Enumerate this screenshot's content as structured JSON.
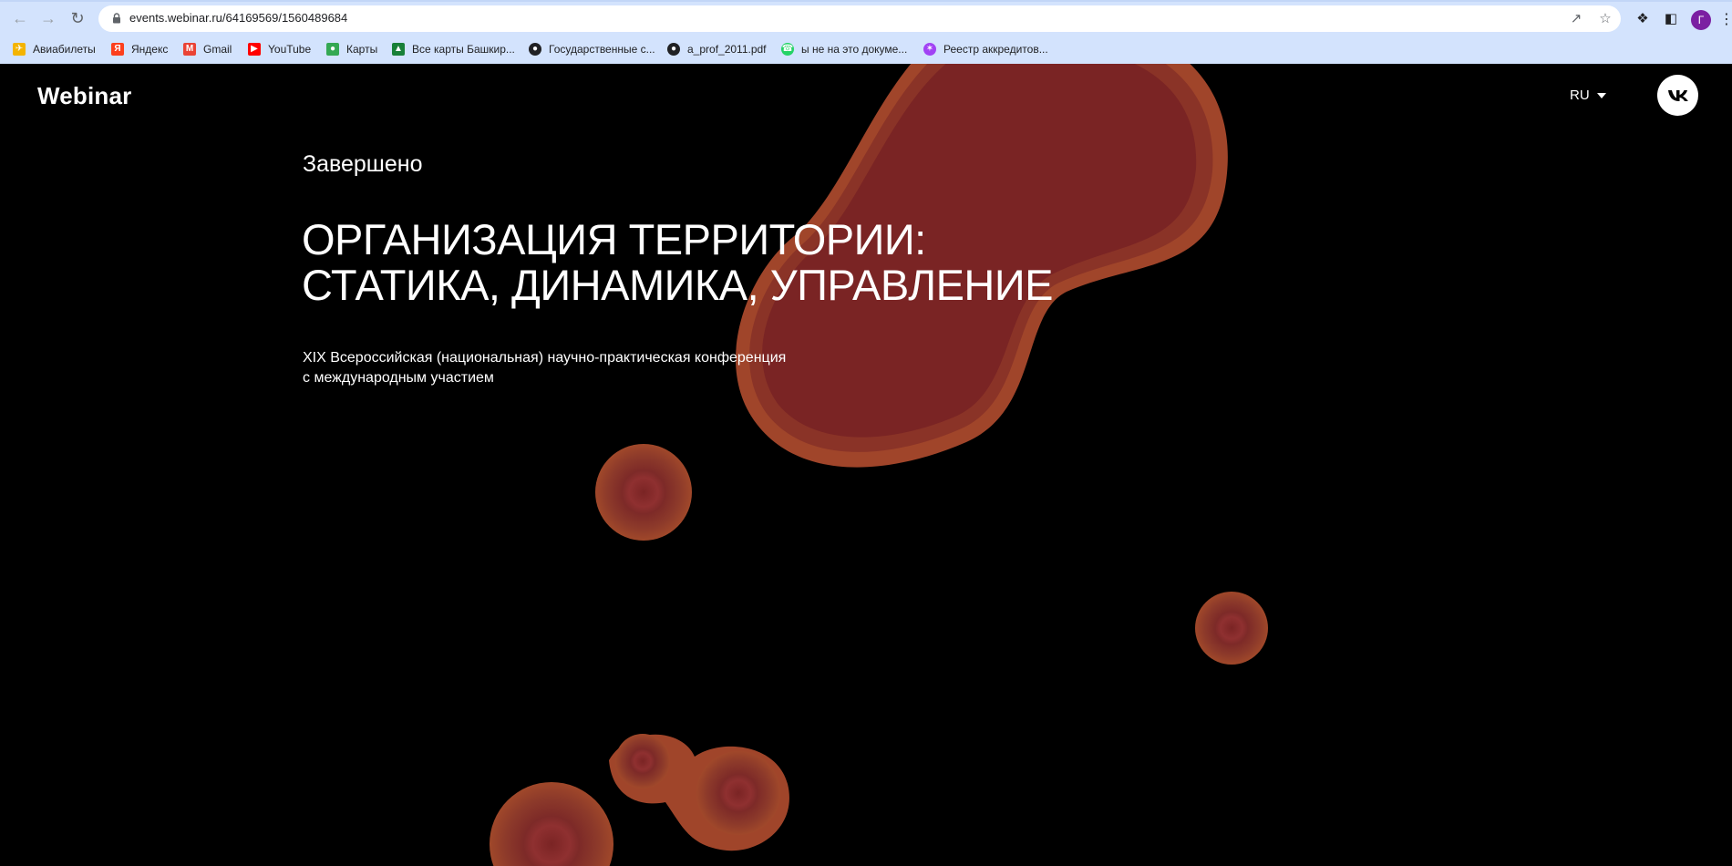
{
  "browser": {
    "url": "events.webinar.ru/64169569/1560489684",
    "profile_initial": "Г",
    "bookmarks": [
      {
        "label": "Авиабилеты",
        "icon": "plane-icon",
        "color": "#f4b400"
      },
      {
        "label": "Яндекс",
        "icon": "yandex-icon",
        "color": "#fc3f1d"
      },
      {
        "label": "Gmail",
        "icon": "gmail-icon",
        "color": "#ea4335"
      },
      {
        "label": "YouTube",
        "icon": "youtube-icon",
        "color": "#ff0000"
      },
      {
        "label": "Карты",
        "icon": "maps-pin-icon",
        "color": "#34a853"
      },
      {
        "label": "Все карты Башкир...",
        "icon": "mountain-icon",
        "color": "#188038"
      },
      {
        "label": "Государственные с...",
        "icon": "globe-icon",
        "color": "#202124"
      },
      {
        "label": "a_prof_2011.pdf",
        "icon": "globe-icon",
        "color": "#202124"
      },
      {
        "label": "ы не на это докуме...",
        "icon": "whatsapp-icon",
        "color": "#25d366"
      },
      {
        "label": "Реестр аккредитов...",
        "icon": "registry-icon",
        "color": "#a142f4"
      }
    ]
  },
  "header": {
    "brand": "Webinar",
    "language": "RU"
  },
  "event": {
    "status": "Завершено",
    "title_line1": "ОРГАНИЗАЦИЯ ТЕРРИТОРИИ:",
    "title_line2": "СТАТИКА, ДИНАМИКА, УПРАВЛЕНИЕ",
    "subtitle_line1": "XIX Всероссийская (национальная) научно-практическая конференция",
    "subtitle_line2": "с международным участием"
  },
  "colors": {
    "background": "#000000",
    "blob_inner": "#7a2424",
    "blob_outer": "#a0452a"
  }
}
